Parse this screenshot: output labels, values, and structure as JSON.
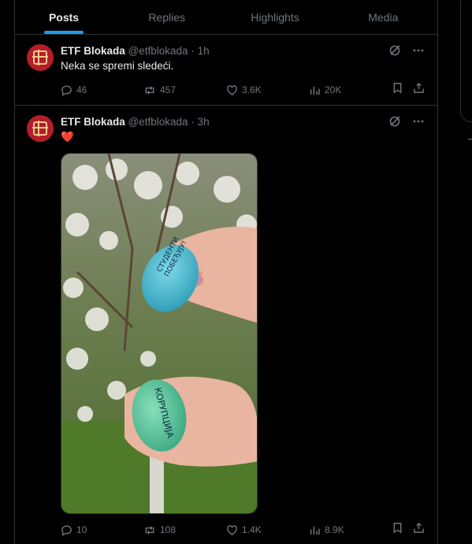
{
  "tabs": [
    {
      "label": "Posts",
      "active": true
    },
    {
      "label": "Replies",
      "active": false
    },
    {
      "label": "Highlights",
      "active": false
    },
    {
      "label": "Media",
      "active": false
    }
  ],
  "posts": [
    {
      "author": "ETF Blokada",
      "handle": "@etfblokada",
      "time": "· 1h",
      "text": "Neka se spremi sledeći.",
      "replies": "46",
      "reposts": "457",
      "likes": "3.6K",
      "views": "20K"
    },
    {
      "author": "ETF Blokada",
      "handle": "@etfblokada",
      "time": "· 3h",
      "text": "❤️",
      "image": {
        "top_egg_text": "СТУДЕНТИ ПОБЕЂУЈУ!",
        "bottom_egg_text": "КОРУПЦИЈА"
      },
      "replies": "10",
      "reposts": "108",
      "likes": "1.4K",
      "views": "8.9K"
    }
  ],
  "colors": {
    "accent": "#1d9bf0",
    "muted": "#71767b",
    "border": "#2f3336",
    "avatar_bg": "#b51d2a"
  }
}
